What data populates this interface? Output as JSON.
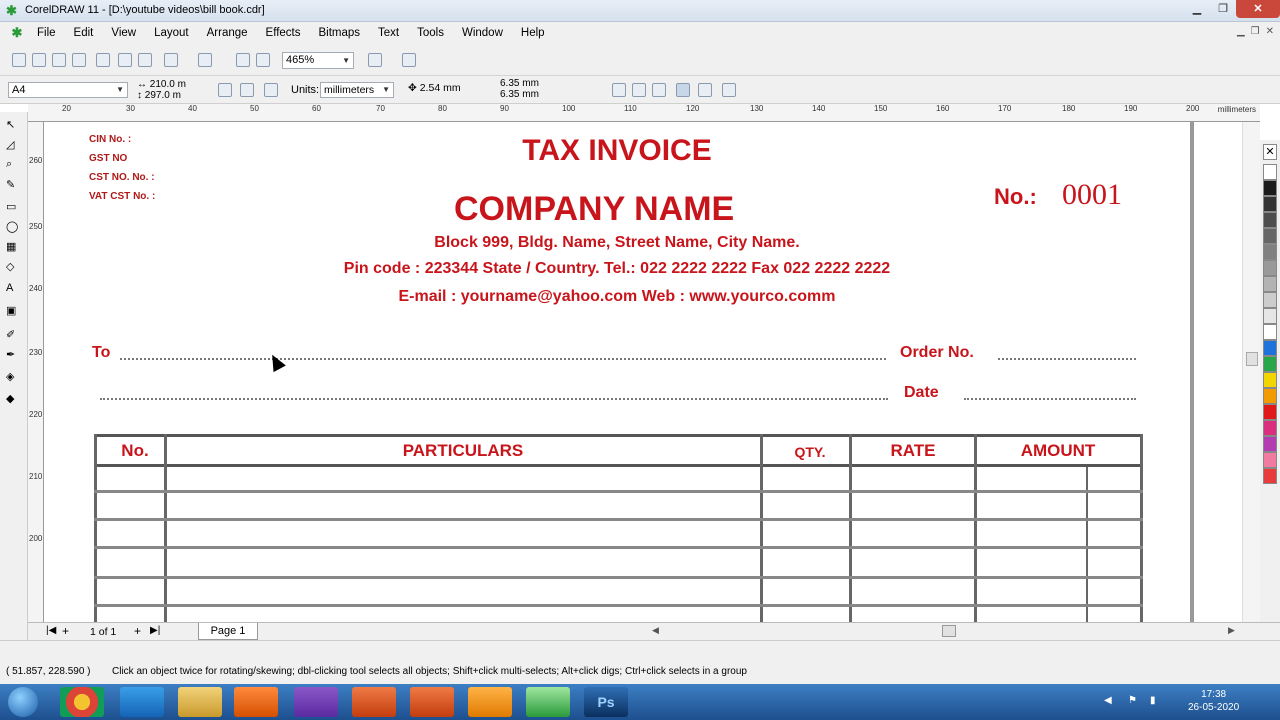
{
  "window": {
    "title": "CorelDRAW 11 - [D:\\youtube videos\\bill book.cdr]",
    "icon": "coreldraw-icon",
    "buttons": [
      "minimize-icon",
      "maximize-icon",
      "close-icon"
    ]
  },
  "menubar": {
    "items": [
      "File",
      "Edit",
      "View",
      "Layout",
      "Arrange",
      "Effects",
      "Bitmaps",
      "Text",
      "Tools",
      "Window",
      "Help"
    ]
  },
  "toolbar": {
    "zoom": "465%",
    "icons": [
      "new-icon",
      "open-icon",
      "save-icon",
      "print-icon",
      "cut-icon",
      "copy-icon",
      "paste-icon",
      "undo-icon",
      "redo-icon",
      "import-icon",
      "export-icon",
      "application-launcher-icon",
      "corel-online-icon"
    ]
  },
  "propertybar": {
    "paper": "A4",
    "width": "210.0 m",
    "height": "297.0 m",
    "units_label": "Units:",
    "units": "millimeters",
    "nudge": "2.54 mm",
    "dup_x": "6.35 mm",
    "dup_y": "6.35 mm"
  },
  "rulers": {
    "unit": "millimeters",
    "h_ticks": [
      "20",
      "30",
      "40",
      "50",
      "60",
      "70",
      "80",
      "90",
      "100",
      "110",
      "120",
      "130",
      "140",
      "150",
      "160",
      "170",
      "180",
      "190",
      "200"
    ],
    "v_ticks": [
      "260",
      "250",
      "240",
      "230",
      "220",
      "210",
      "200"
    ]
  },
  "document": {
    "title": "TAX INVOICE",
    "company": "COMPANY NAME",
    "left_labels": [
      "CIN No. :",
      "GST NO",
      "CST NO. No. :",
      "VAT CST No. :"
    ],
    "invoice_no_label": "No.:",
    "invoice_no": "0001",
    "address_line1": "Block 999, Bldg. Name, Street Name, City Name.",
    "address_line2": "Pin code : 223344 State / Country. Tel.: 022 2222 2222 Fax 022 2222 2222",
    "address_line3": "E-mail : yourname@yahoo.com Web : www.yourco.comm",
    "to_label": "To",
    "order_label": "Order No.",
    "date_label": "Date",
    "table_headers": [
      "No.",
      "PARTICULARS",
      "QTY.",
      "RATE",
      "AMOUNT"
    ]
  },
  "pagebar": {
    "counter": "1 of 1",
    "page_tab": "Page 1"
  },
  "status": {
    "coords": "( 51.857, 228.590 )",
    "hint": "Click an object twice for rotating/skewing; dbl-clicking tool selects all objects; Shift+click multi-selects; Alt+click digs; Ctrl+click selects in a group"
  },
  "taskbar": {
    "time": "17:38",
    "date": "26-05-2020",
    "apps": [
      "chrome-icon",
      "internet-explorer-icon",
      "file-explorer-icon",
      "media-player-icon",
      "screen-recorder-icon",
      "powerpoint-icon",
      "powerpoint-icon-2",
      "vlc-icon",
      "coreldraw-task-icon",
      "photoshop-icon"
    ]
  },
  "palette_colors": [
    "#ffffff",
    "#1a1a1a",
    "#333333",
    "#4d4d4d",
    "#666666",
    "#808080",
    "#999999",
    "#b3b3b3",
    "#cccccc",
    "#e6e6e6",
    "#ffffff",
    "#1e72d9",
    "#2aa64a",
    "#f2d400",
    "#f29b00",
    "#e01818",
    "#d92f7e",
    "#b33cb3",
    "#f07aa0",
    "#e83c3c"
  ]
}
